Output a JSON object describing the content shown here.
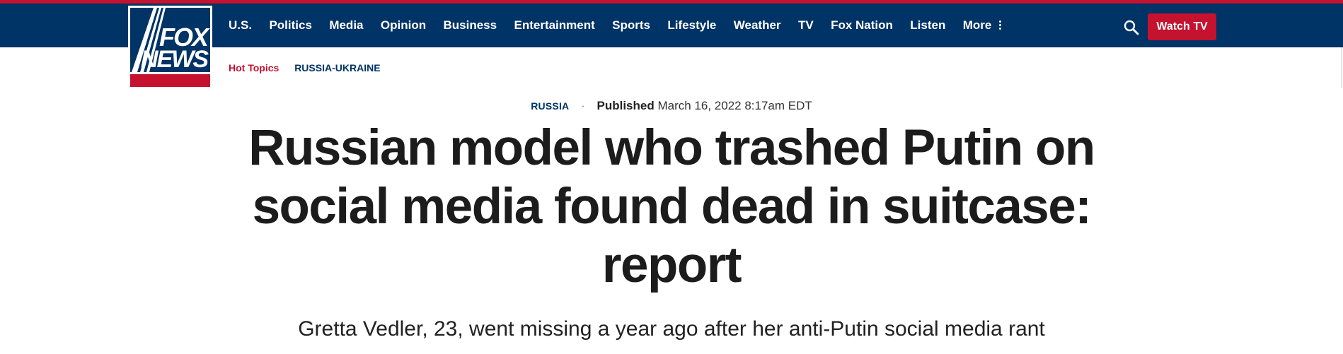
{
  "brand": {
    "logo_line1": "FOX",
    "logo_line2": "NEWS",
    "accent_red": "#c4122f",
    "navy": "#003366"
  },
  "nav": {
    "items": [
      {
        "label": "U.S."
      },
      {
        "label": "Politics"
      },
      {
        "label": "Media"
      },
      {
        "label": "Opinion"
      },
      {
        "label": "Business"
      },
      {
        "label": "Entertainment"
      },
      {
        "label": "Sports"
      },
      {
        "label": "Lifestyle"
      },
      {
        "label": "Weather"
      },
      {
        "label": "TV"
      },
      {
        "label": "Fox Nation"
      },
      {
        "label": "Listen"
      },
      {
        "label": "More"
      }
    ],
    "search_icon": "search-icon",
    "more_icon": "vertical-dots-icon",
    "watch_tv_label": "Watch TV"
  },
  "hot_topics": {
    "label": "Hot Topics",
    "links": [
      "RUSSIA-UKRAINE"
    ]
  },
  "article": {
    "category": "RUSSIA",
    "separator": "·",
    "published_label": "Published",
    "published_date": "March 16, 2022 8:17am EDT",
    "headline": "Russian model who trashed Putin on social media found dead in suitcase: report",
    "subheadline": "Gretta Vedler, 23, went missing a year ago after her anti-Putin social media rant"
  }
}
